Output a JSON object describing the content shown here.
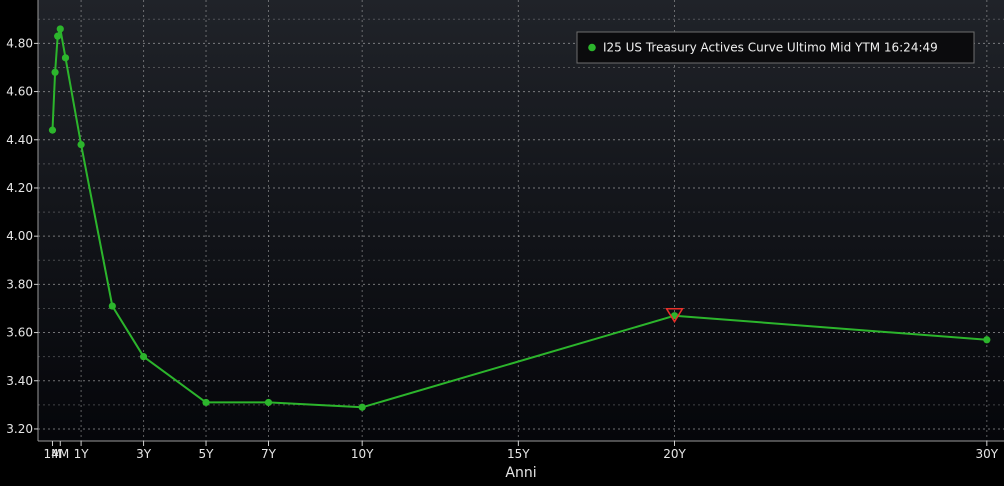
{
  "chart_data": {
    "type": "line",
    "title": "",
    "xlabel": "Anni",
    "ylabel": "",
    "ylim": [
      3.15,
      4.98
    ],
    "xlim": [
      -0.38,
      30.55
    ],
    "y_ticks": [
      3.2,
      3.4,
      3.6,
      3.8,
      4.0,
      4.2,
      4.4,
      4.6,
      4.8
    ],
    "y_tick_labels": [
      "3.20",
      "3.40",
      "3.60",
      "3.80",
      "4.00",
      "4.20",
      "4.40",
      "4.60",
      "4.80"
    ],
    "x_ticks": [
      0.0833,
      0.333,
      1,
      3,
      5,
      7,
      10,
      15,
      20,
      30
    ],
    "x_tick_labels": [
      "1M",
      "4M",
      "1Y",
      "3Y",
      "5Y",
      "7Y",
      "10Y",
      "15Y",
      "20Y",
      "30Y"
    ],
    "grid": true,
    "legend_position": "top-right",
    "series": [
      {
        "name": "I25 US Treasury Actives Curve Ultimo Mid YTM 16:24:49",
        "color": "#2cb52c",
        "points": [
          {
            "x": 0.0833,
            "y": 4.44
          },
          {
            "x": 0.1667,
            "y": 4.68
          },
          {
            "x": 0.25,
            "y": 4.83
          },
          {
            "x": 0.333,
            "y": 4.86
          },
          {
            "x": 0.5,
            "y": 4.74
          },
          {
            "x": 1,
            "y": 4.38
          },
          {
            "x": 2,
            "y": 3.71
          },
          {
            "x": 3,
            "y": 3.5
          },
          {
            "x": 5,
            "y": 3.31
          },
          {
            "x": 7,
            "y": 3.31
          },
          {
            "x": 10,
            "y": 3.29
          },
          {
            "x": 20,
            "y": 3.67
          },
          {
            "x": 30,
            "y": 3.57
          }
        ]
      }
    ],
    "annotations": [
      {
        "type": "marker",
        "shape": "triangle-down",
        "color": "#e8302a",
        "x": 20,
        "y": 3.67
      }
    ]
  }
}
